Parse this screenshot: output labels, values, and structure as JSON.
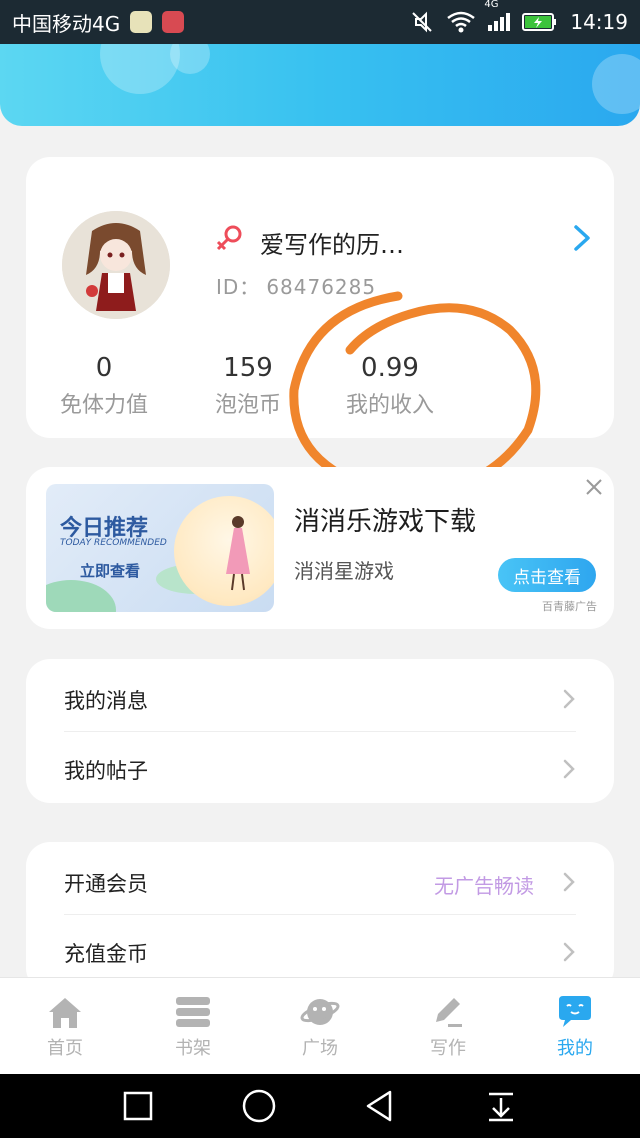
{
  "status_bar": {
    "carrier": "中国移动4G",
    "network": "4G",
    "time": "14:19"
  },
  "profile": {
    "username": "爱写作的历…",
    "id_label": "ID：",
    "id_value": "68476285",
    "stats": [
      {
        "value": "0",
        "label": "免体力值"
      },
      {
        "value": "159",
        "label": "泡泡币"
      },
      {
        "value": "0.99",
        "label": "我的收入"
      }
    ]
  },
  "ad": {
    "banner_title": "今日推荐",
    "banner_subtitle": "TODAY RECOMMENDED",
    "banner_cta": "立即查看",
    "title": "消消乐游戏下载",
    "subtitle": "消消星游戏",
    "button": "点击查看",
    "source": "百青藤广告"
  },
  "menu_group_1": [
    {
      "label": "我的消息"
    },
    {
      "label": "我的帖子"
    }
  ],
  "menu_group_2": [
    {
      "label": "开通会员",
      "hint": "无广告畅读"
    },
    {
      "label": "充值金币"
    }
  ],
  "tabs": [
    {
      "label": "首页",
      "icon": "home-icon"
    },
    {
      "label": "书架",
      "icon": "bookshelf-icon"
    },
    {
      "label": "广场",
      "icon": "planet-icon"
    },
    {
      "label": "写作",
      "icon": "pen-icon"
    },
    {
      "label": "我的",
      "icon": "chat-bubble-icon",
      "active": true
    }
  ],
  "colors": {
    "accent": "#2aa8ef",
    "annotation": "#f0852c",
    "hint_text": "#c29ae4"
  }
}
